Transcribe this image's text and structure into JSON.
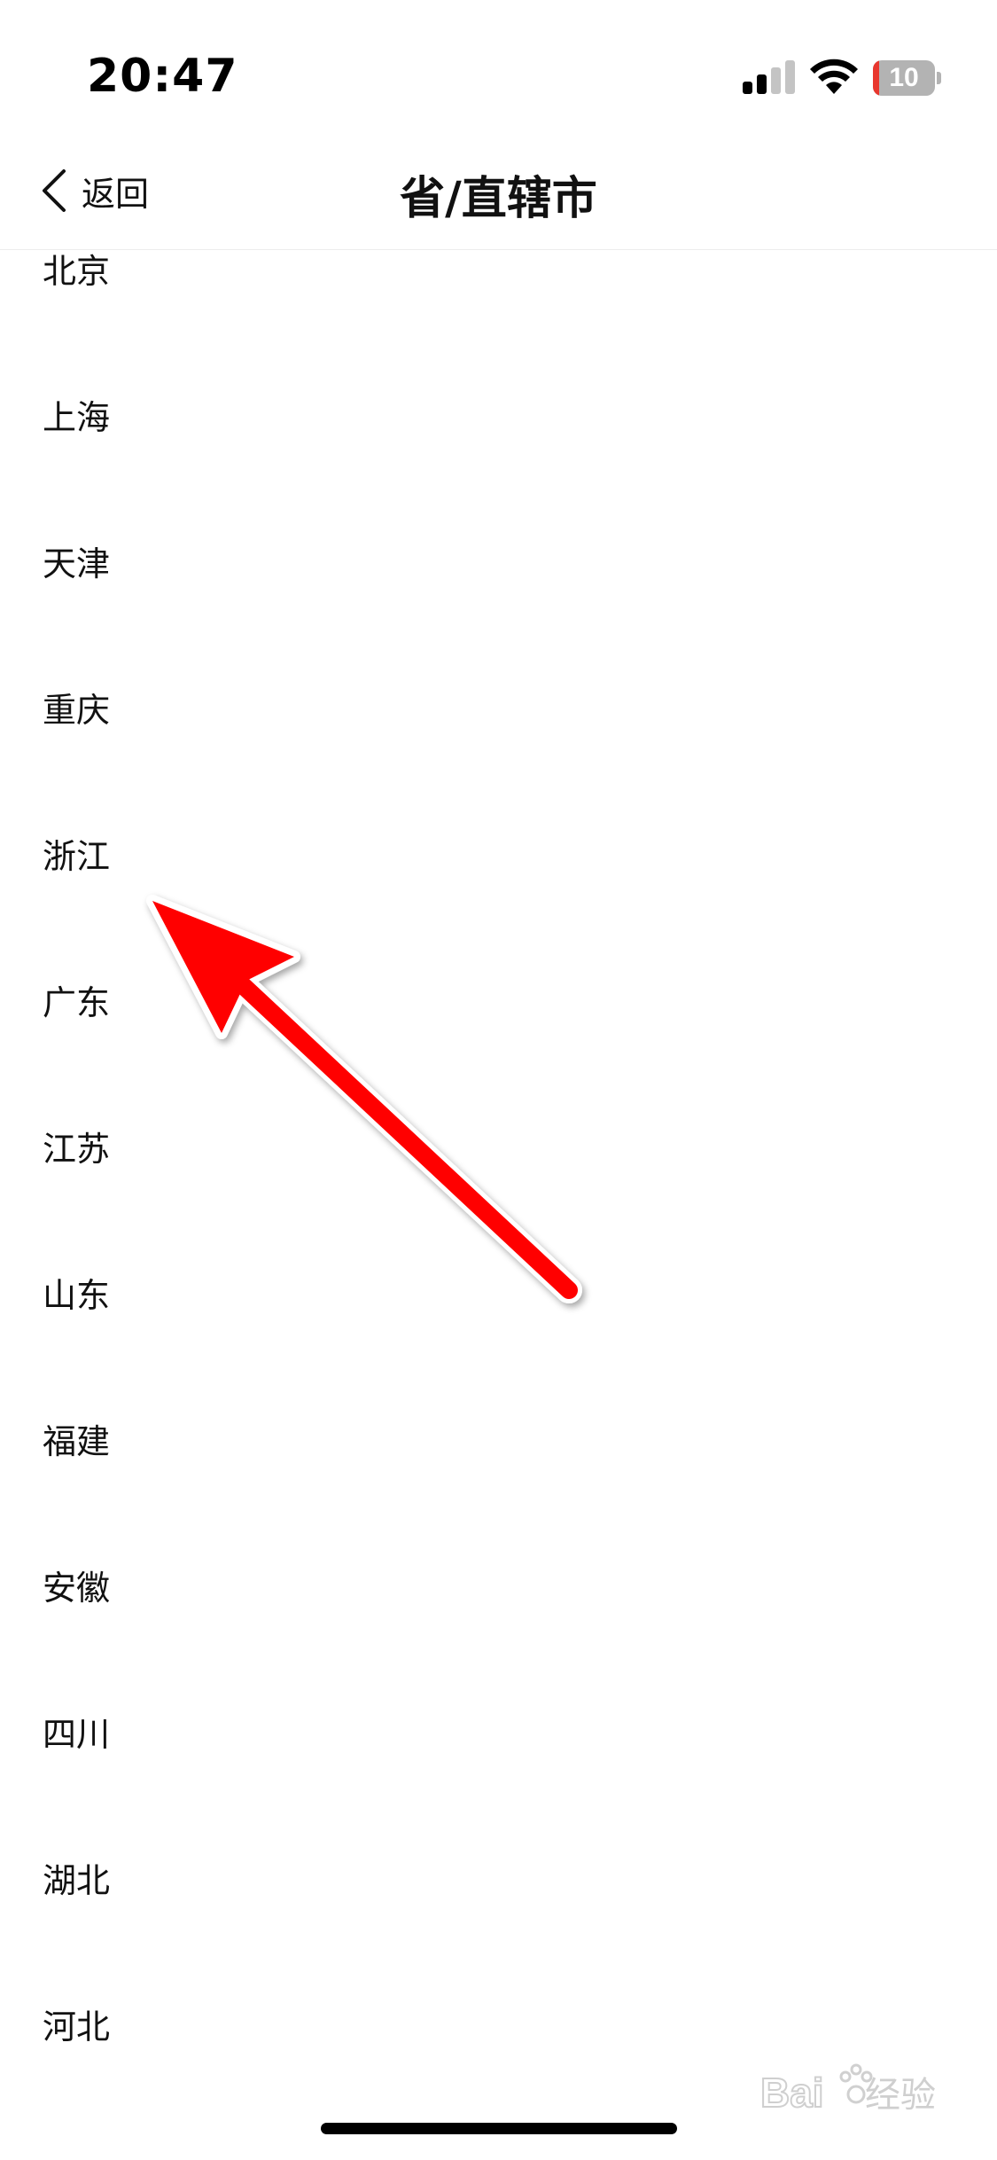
{
  "status_bar": {
    "time": "20:47",
    "battery_level": "10",
    "battery_fraction": 0.1,
    "icons": [
      "signal-icon",
      "wifi-icon",
      "battery-icon"
    ]
  },
  "nav": {
    "back_label": "返回",
    "title": "省/直辖市",
    "back_icon": "chevron-left-icon"
  },
  "provinces": [
    {
      "label": "北京"
    },
    {
      "label": "上海"
    },
    {
      "label": "天津"
    },
    {
      "label": "重庆"
    },
    {
      "label": "浙江"
    },
    {
      "label": "广东"
    },
    {
      "label": "江苏"
    },
    {
      "label": "山东"
    },
    {
      "label": "福建"
    },
    {
      "label": "安徽"
    },
    {
      "label": "四川"
    },
    {
      "label": "湖北"
    },
    {
      "label": "河北"
    }
  ],
  "annotation": {
    "icon": "red-arrow-icon",
    "color": "#ff0000"
  },
  "watermark": {
    "text": "Baidu经验",
    "icon": "baidu-paw-logo"
  }
}
